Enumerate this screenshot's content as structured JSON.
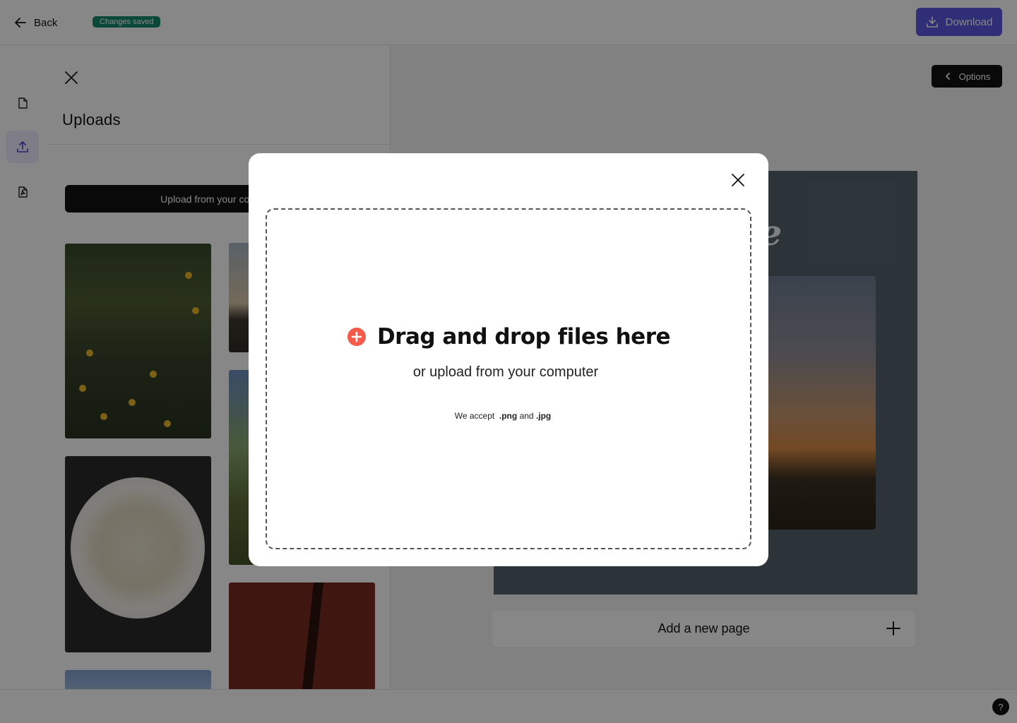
{
  "header": {
    "back_label": "Back",
    "saved_badge": "Changes saved",
    "download_label": "Download"
  },
  "rail": {
    "items": [
      {
        "icon": "page-icon"
      },
      {
        "icon": "upload-icon",
        "active": true
      },
      {
        "icon": "pdf-icon"
      }
    ]
  },
  "uploads_panel": {
    "title": "Uploads",
    "upload_button_label": "Upload from your computer"
  },
  "canvas": {
    "options_label": "Options",
    "headline": "Release",
    "add_page_label": "Add a new page"
  },
  "help_label": "?",
  "modal": {
    "title": "Drag and drop files here",
    "subtitle": "or upload from your computer",
    "accept_prefix": "We accept",
    "accept_png": ".png",
    "accept_and": "and",
    "accept_jpg": ".jpg",
    "accent_color": "#f45b4a"
  },
  "colors": {
    "download_bg": "#5b57e0",
    "saved_badge_bg": "#138a6b",
    "page_bg": "#55626d"
  }
}
